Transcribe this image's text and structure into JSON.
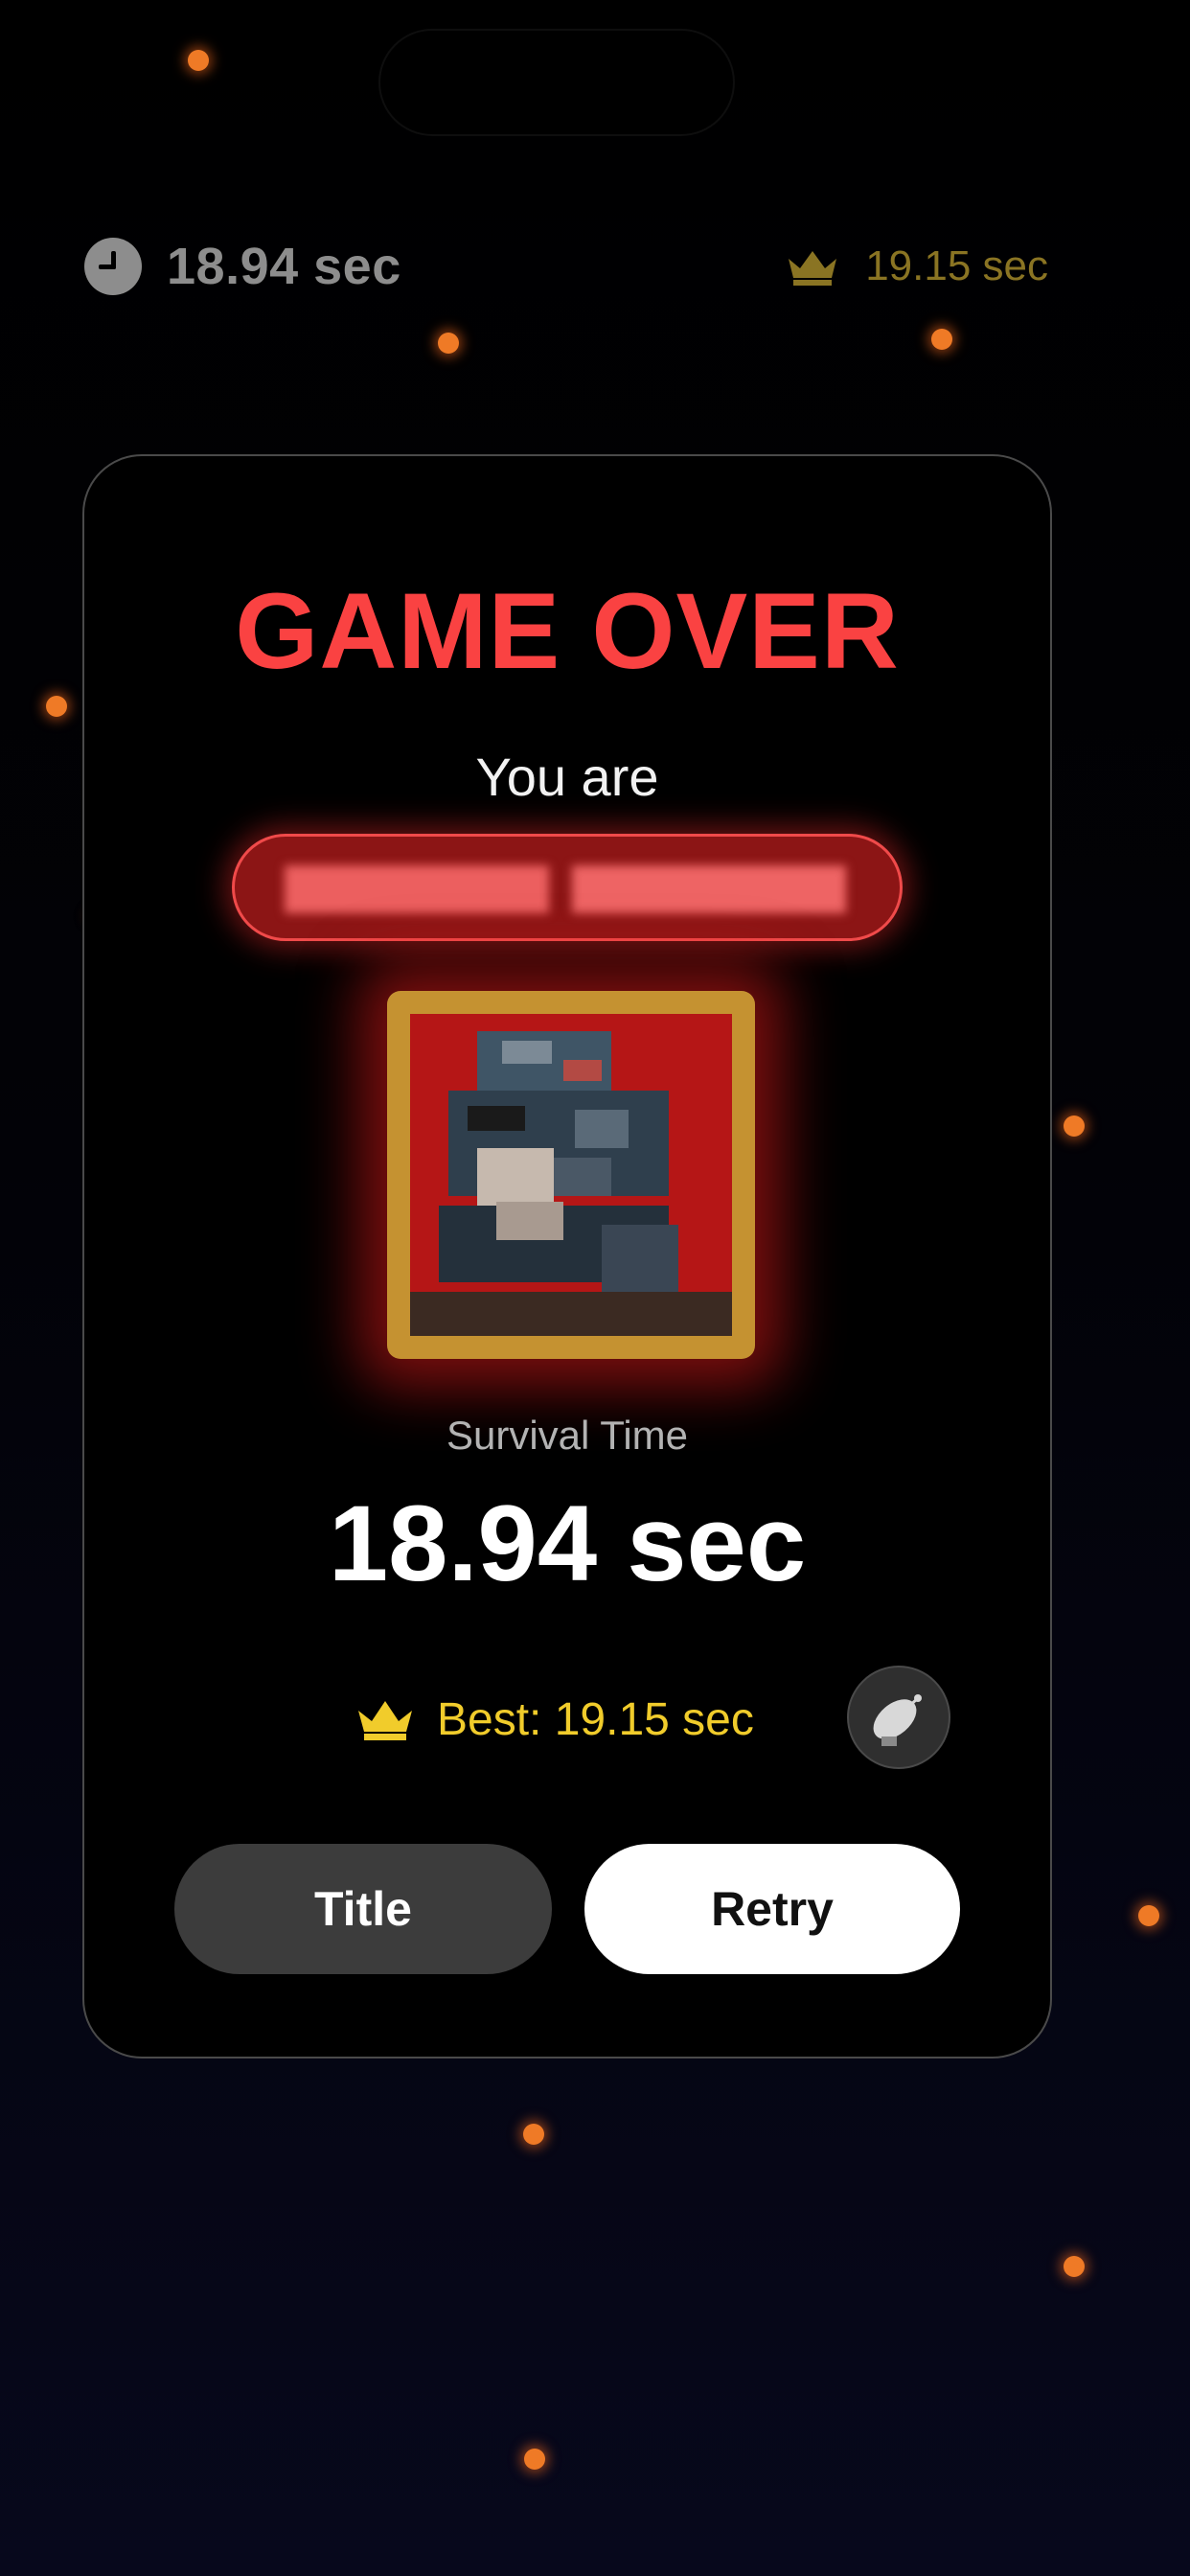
{
  "hud": {
    "clock_icon": "clock-icon",
    "current_time": "18.94 sec",
    "crown_icon": "crown-icon",
    "best_time": "19.15 sec"
  },
  "modal": {
    "title": "GAME OVER",
    "subtitle": "You are",
    "survival_label": "Survival Time",
    "survival_value": "18.94 sec",
    "best_label": "Best: 19.15 sec",
    "share_icon": "satellite-dish-icon",
    "title_button_label": "Title",
    "retry_button_label": "Retry"
  },
  "colors": {
    "title_red": "#fa4242",
    "best_gold": "#f1cc2b",
    "hud_gold": "#8a7423",
    "ember_orange": "#ef7a26",
    "frame_gold": "#c59231"
  }
}
